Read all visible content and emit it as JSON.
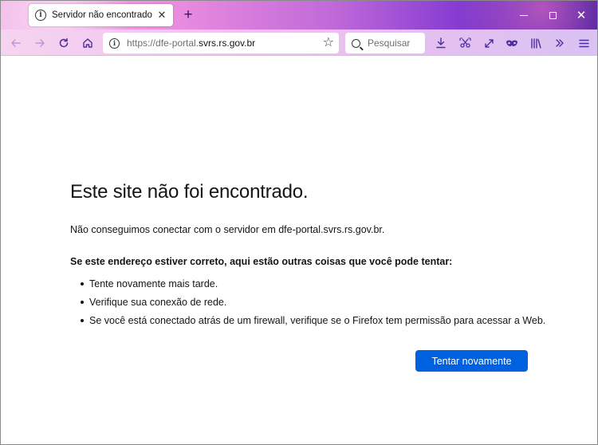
{
  "browser": {
    "tab": {
      "title": "Servidor não encontrado",
      "icon": "info-icon"
    },
    "new_tab_label": "+",
    "url": {
      "prefix": "https://dfe-portal.",
      "host": "svrs.rs.gov.br"
    },
    "search_placeholder": "Pesquisar",
    "toolbar_icons": [
      "download-icon",
      "screenshot-icon",
      "fullscreen-icon",
      "private-mask-icon",
      "library-icon",
      "overflow-icon",
      "menu-icon"
    ]
  },
  "error_page": {
    "title": "Este site não foi encontrado.",
    "description": "Não conseguimos conectar com o servidor em dfe-portal.svrs.rs.gov.br.",
    "suggestions_heading": "Se este endereço estiver correto, aqui estão outras coisas que você pode tentar:",
    "suggestions": [
      "Tente novamente mais tarde.",
      "Verifique sua conexão de rede.",
      "Se você está conectado atrás de um firewall, verifique se o Firefox tem permissão para acessar a Web."
    ],
    "retry_label": "Tentar novamente"
  },
  "colors": {
    "accent_button": "#0061e0",
    "text": "#15141a"
  }
}
